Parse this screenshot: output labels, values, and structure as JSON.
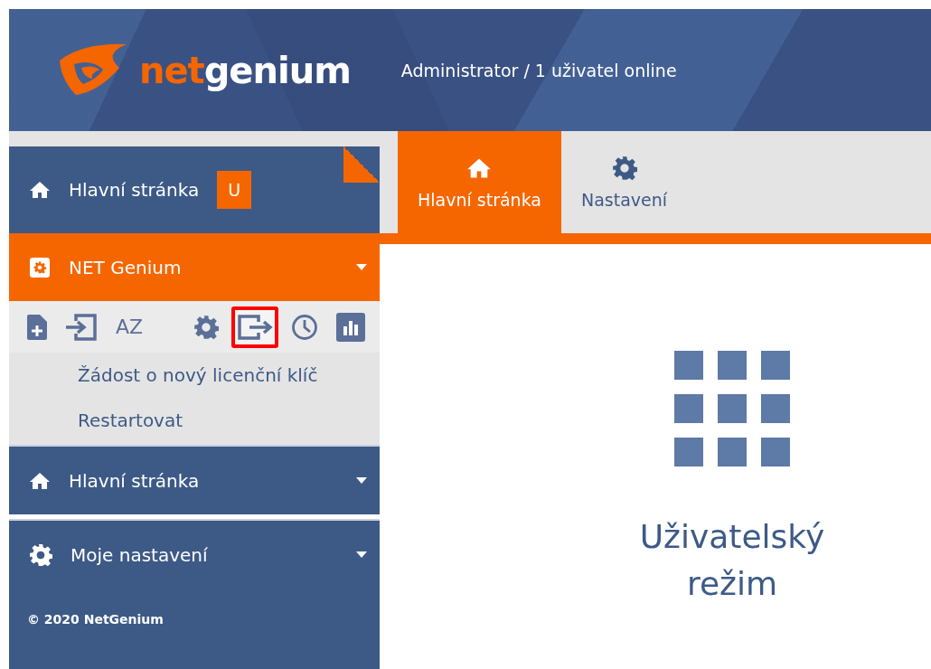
{
  "header": {
    "logo": {
      "part1": "net",
      "part2": "genium"
    },
    "user_status": "Administrator / 1 uživatel online"
  },
  "sidebar": {
    "home": {
      "label": "Hlavní stránka",
      "badge": "U"
    },
    "sections": [
      {
        "label": "NET Genium",
        "kind": "settings",
        "expanded": true,
        "toolbar_left": [
          {
            "kind": "file-plus",
            "highlighted": false
          },
          {
            "kind": "import",
            "highlighted": false
          },
          {
            "kind": "text",
            "text": "AZ",
            "highlighted": false
          }
        ],
        "toolbar_right": [
          {
            "kind": "gear",
            "highlighted": false
          },
          {
            "kind": "export",
            "highlighted": true
          },
          {
            "kind": "clock",
            "highlighted": false
          },
          {
            "kind": "chart",
            "highlighted": false
          }
        ],
        "items": [
          "Žádost o nový licenční klíč",
          "Restartovat"
        ]
      },
      {
        "label": "Hlavní stránka",
        "kind": "home",
        "expanded": false
      },
      {
        "label": "Moje nastavení",
        "kind": "settings",
        "expanded": false
      }
    ],
    "footer": "© 2020 NetGenium"
  },
  "tabs": [
    {
      "label": "Hlavní stránka",
      "kind": "home",
      "selected": true
    },
    {
      "label": "Nastavení",
      "kind": "settings",
      "selected": false
    }
  ],
  "main": {
    "title": "Uživatelský režim"
  }
}
